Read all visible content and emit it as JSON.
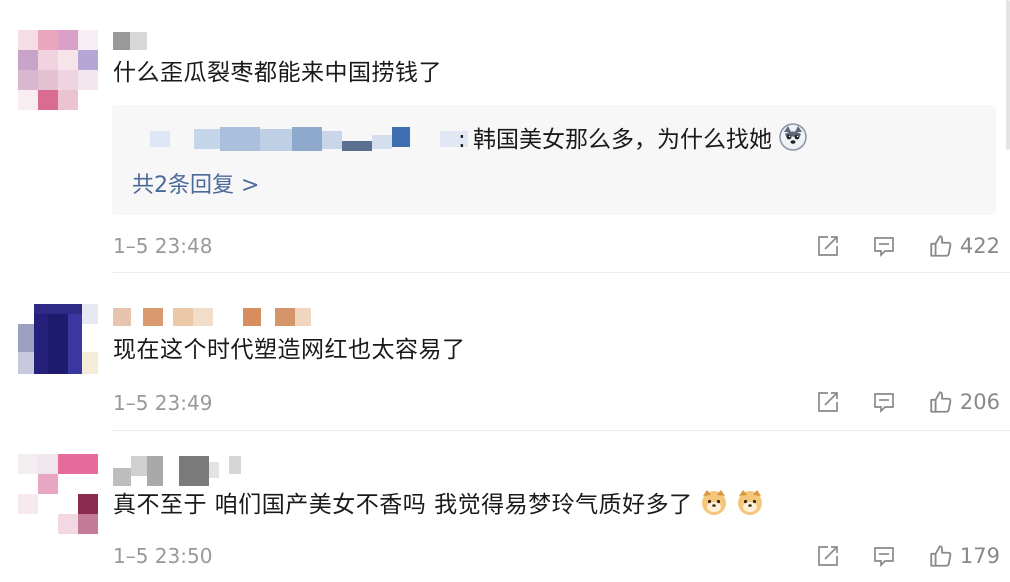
{
  "comments": [
    {
      "text": "什么歪瓜裂枣都能来中国捞钱了",
      "reply": {
        "text": ": 韩国美女那么多，为什么找她",
        "emoji": "husky-face-emoji",
        "more": "共2条回复 >"
      },
      "time": "1–5 23:48",
      "likes": "422"
    },
    {
      "text": "现在这个时代塑造网红也太容易了",
      "time": "1–5 23:49",
      "likes": "206"
    },
    {
      "text": "真不至于 咱们国产美女不香吗 我觉得易梦玲气质好多了",
      "emoji": "dog-face-emoji",
      "time": "1–5 23:50",
      "likes": "179"
    }
  ],
  "icons": {
    "share": "share-icon",
    "comment": "comment-icon",
    "like": "thumbs-up-icon"
  },
  "colors": {
    "time": "#999999",
    "reply_link": "#4a6a9a",
    "reply_bg": "#f7f7f8"
  }
}
